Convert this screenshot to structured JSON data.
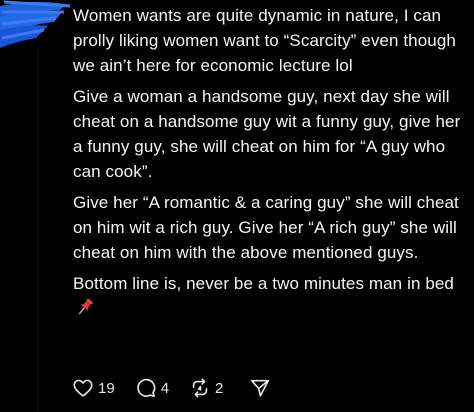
{
  "post": {
    "paragraphs": [
      "Women wants are quite dynamic in nature, I can prolly liking women want to “Scarcity” even though we ain’t here for economic lecture lol",
      "Give a woman a handsome guy, next day she will cheat on a handsome guy wit a funny guy, give her a funny guy, she will cheat on him for “A guy who can cook”.",
      "Give her “A romantic & a caring guy” she will cheat on him wit a rich guy. Give her “A rich guy” she will cheat on him with the above mentioned guys.",
      "Bottom line is, never be a two minutes man in bed"
    ],
    "pin_icon": "pushpin-icon"
  },
  "actions": {
    "like": {
      "icon": "heart-icon",
      "count": "19"
    },
    "reply": {
      "icon": "comment-icon",
      "count": "4"
    },
    "repost": {
      "icon": "repost-icon",
      "count": "2"
    },
    "share": {
      "icon": "send-icon"
    }
  },
  "colors": {
    "background": "#000000",
    "text": "#f3f5f7",
    "redaction": "#1f5fe0",
    "pin": "#e0334a"
  }
}
